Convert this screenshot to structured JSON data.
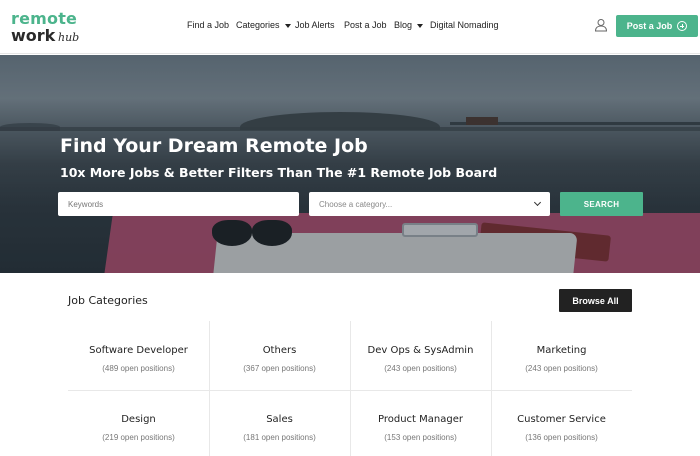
{
  "logo": {
    "line1": "remote",
    "line2": "work",
    "line3": "hub"
  },
  "nav": {
    "items": [
      {
        "label": "Find a Job",
        "dropdown": false
      },
      {
        "label": "Categories",
        "dropdown": true
      },
      {
        "label": "Job Alerts",
        "dropdown": false
      },
      {
        "label": "Post a Job",
        "dropdown": false
      },
      {
        "label": "Blog",
        "dropdown": true
      },
      {
        "label": "Digital Nomading",
        "dropdown": false
      }
    ],
    "post_button": "Post a Job"
  },
  "hero": {
    "title": "Find Your Dream Remote Job",
    "subtitle": "10x More Jobs & Better Filters Than The #1 Remote Job Board",
    "keywords_placeholder": "Keywords",
    "category_placeholder": "Choose a category...",
    "search_label": "SEARCH"
  },
  "categories": {
    "heading": "Job Categories",
    "browse_label": "Browse All",
    "items": [
      {
        "name": "Software Developer",
        "count": "(489 open positions)"
      },
      {
        "name": "Others",
        "count": "(367 open positions)"
      },
      {
        "name": "Dev Ops & SysAdmin",
        "count": "(243 open positions)"
      },
      {
        "name": "Marketing",
        "count": "(243 open positions)"
      },
      {
        "name": "Design",
        "count": "(219 open positions)"
      },
      {
        "name": "Sales",
        "count": "(181 open positions)"
      },
      {
        "name": "Product Manager",
        "count": "(153 open positions)"
      },
      {
        "name": "Customer Service",
        "count": "(136 open positions)"
      }
    ]
  },
  "colors": {
    "accent": "#4cb48c",
    "dark_button": "#222222"
  }
}
